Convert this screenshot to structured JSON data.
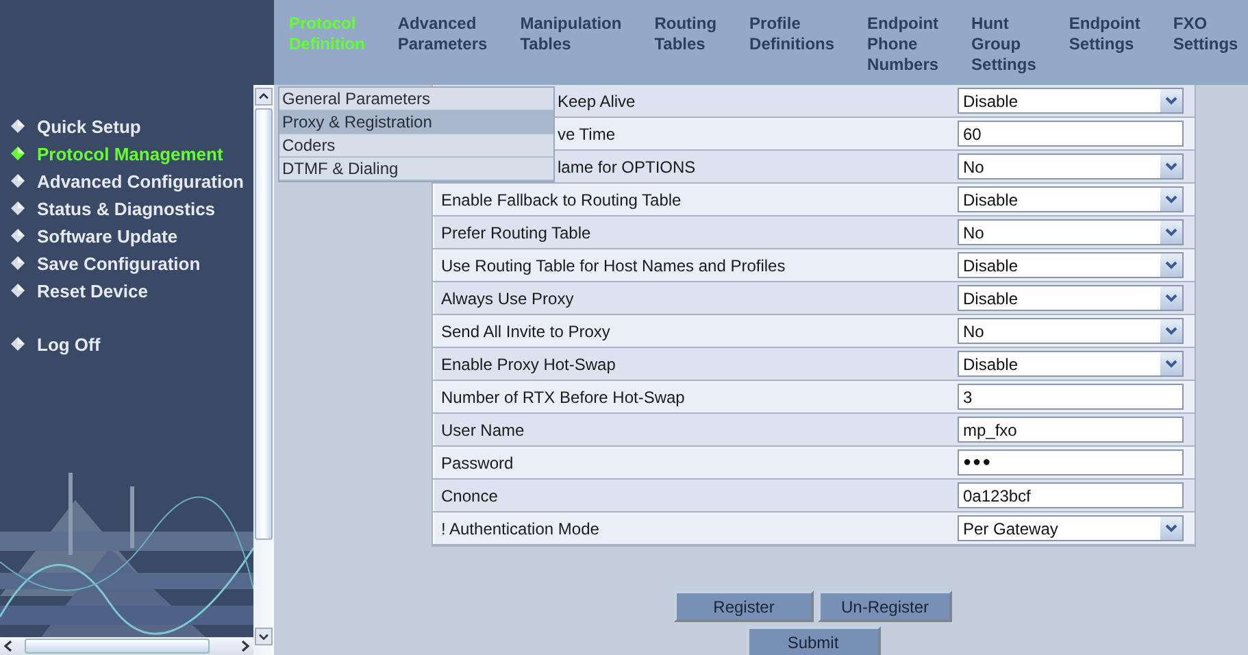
{
  "tabs": [
    {
      "label": "Protocol Definition",
      "selected": true
    },
    {
      "label": "Advanced Parameters",
      "selected": false
    },
    {
      "label": "Manipulation Tables",
      "selected": false
    },
    {
      "label": "Routing Tables",
      "selected": false
    },
    {
      "label": "Profile Definitions",
      "selected": false
    },
    {
      "label": "Endpoint Phone Numbers",
      "selected": false
    },
    {
      "label": "Hunt Group Settings",
      "selected": false
    },
    {
      "label": "Endpoint Settings",
      "selected": false
    },
    {
      "label": "FXO Settings",
      "selected": false
    }
  ],
  "sidebar": {
    "items": [
      {
        "label": "Quick Setup",
        "selected": false
      },
      {
        "label": "Protocol Management",
        "selected": true
      },
      {
        "label": "Advanced Configuration",
        "selected": false
      },
      {
        "label": "Status & Diagnostics",
        "selected": false
      },
      {
        "label": "Software Update",
        "selected": false
      },
      {
        "label": "Save Configuration",
        "selected": false
      },
      {
        "label": "Reset Device",
        "selected": false
      }
    ],
    "logoff": {
      "label": "Log Off"
    }
  },
  "submenu": [
    {
      "label": "General Parameters",
      "selected": false
    },
    {
      "label": "Proxy & Registration",
      "selected": true
    },
    {
      "label": "Coders",
      "selected": false
    },
    {
      "label": "DTMF & Dialing",
      "selected": false
    }
  ],
  "settings": [
    {
      "label": "Keep Alive",
      "covered": true,
      "kind": "select",
      "value": "Disable"
    },
    {
      "label": "ve Time",
      "covered": true,
      "kind": "text",
      "value": "60"
    },
    {
      "label": "lame for OPTIONS",
      "covered": true,
      "kind": "select",
      "value": "No"
    },
    {
      "label": "Enable Fallback to Routing Table",
      "covered": false,
      "kind": "select",
      "value": "Disable"
    },
    {
      "label": "Prefer Routing Table",
      "covered": false,
      "kind": "select",
      "value": "No"
    },
    {
      "label": "Use Routing Table for Host Names and Profiles",
      "covered": false,
      "kind": "select",
      "value": "Disable"
    },
    {
      "label": "Always Use Proxy",
      "covered": false,
      "kind": "select",
      "value": "Disable"
    },
    {
      "label": "Send All Invite to Proxy",
      "covered": false,
      "kind": "select",
      "value": "No"
    },
    {
      "label": "Enable Proxy Hot-Swap",
      "covered": false,
      "kind": "select",
      "value": "Disable"
    },
    {
      "label": "Number of RTX Before Hot-Swap",
      "covered": false,
      "kind": "text",
      "value": "3"
    },
    {
      "label": "User Name",
      "covered": false,
      "kind": "text",
      "value": "mp_fxo"
    },
    {
      "label": "Password",
      "covered": false,
      "kind": "password",
      "value": "●●●"
    },
    {
      "label": "Cnonce",
      "covered": false,
      "kind": "text",
      "value": "0a123bcf"
    },
    {
      "label": "! Authentication Mode",
      "covered": false,
      "kind": "select",
      "value": "Per Gateway"
    }
  ],
  "buttons": [
    {
      "label": "Register"
    },
    {
      "label": "Un-Register"
    },
    {
      "label": "Submit"
    }
  ]
}
